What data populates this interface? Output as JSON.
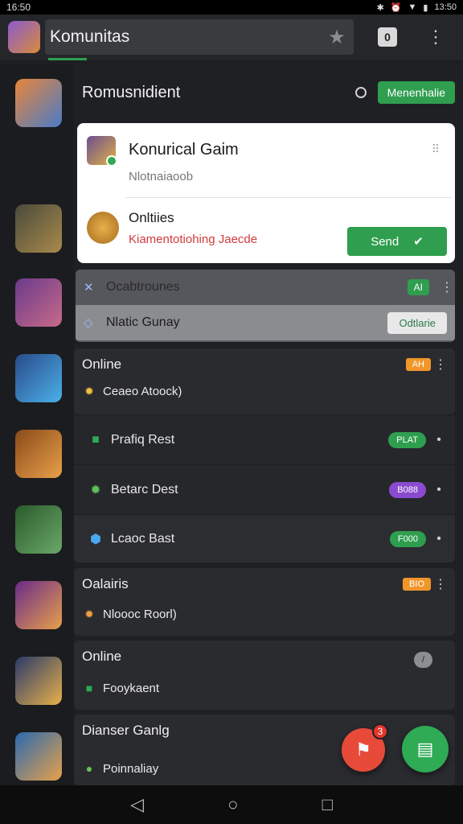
{
  "status_bar": {
    "time": "16:50",
    "right_time": "13:50"
  },
  "app_bar": {
    "title": "Komunitas"
  },
  "section": {
    "title": "Romusnidient",
    "action_label": "Menenhalie"
  },
  "card": {
    "title": "Konurical Gaim",
    "subtitle": "Nlotnaiaoob",
    "bottom_title": "Onltiies",
    "bottom_subtitle": "Kiamentotiohing Jaecde",
    "send_label": "Send"
  },
  "grey_list": [
    {
      "label": "Ocabtrounes",
      "tag": "AI"
    },
    {
      "label": "Nlatic Gunay",
      "action": "Odtlarie"
    }
  ],
  "groups": [
    {
      "head": "Online",
      "badge": "AH",
      "row": "Ceaeo Atoock)"
    },
    {
      "head": "Oalairis",
      "badge": "BIO",
      "row": "Nloooc Roorl)"
    },
    {
      "head": "Online",
      "badge": "/",
      "row": "Fooykaent"
    },
    {
      "head": "Dianser Ganlg",
      "badge": "",
      "row": "Poinnaliay"
    }
  ],
  "items": [
    {
      "label": "Prafiq Rest",
      "pill": "PLAT"
    },
    {
      "label": "Betarc Dest",
      "pill": "B088"
    },
    {
      "label": "Lcaoc Bast",
      "pill": "F000"
    }
  ],
  "fab": {
    "badge": "3"
  },
  "colors": {
    "accent_green": "#2f9e4f",
    "accent_orange": "#f0962b",
    "accent_purple": "#8a4bd0",
    "fab_red": "#e84a3a"
  }
}
